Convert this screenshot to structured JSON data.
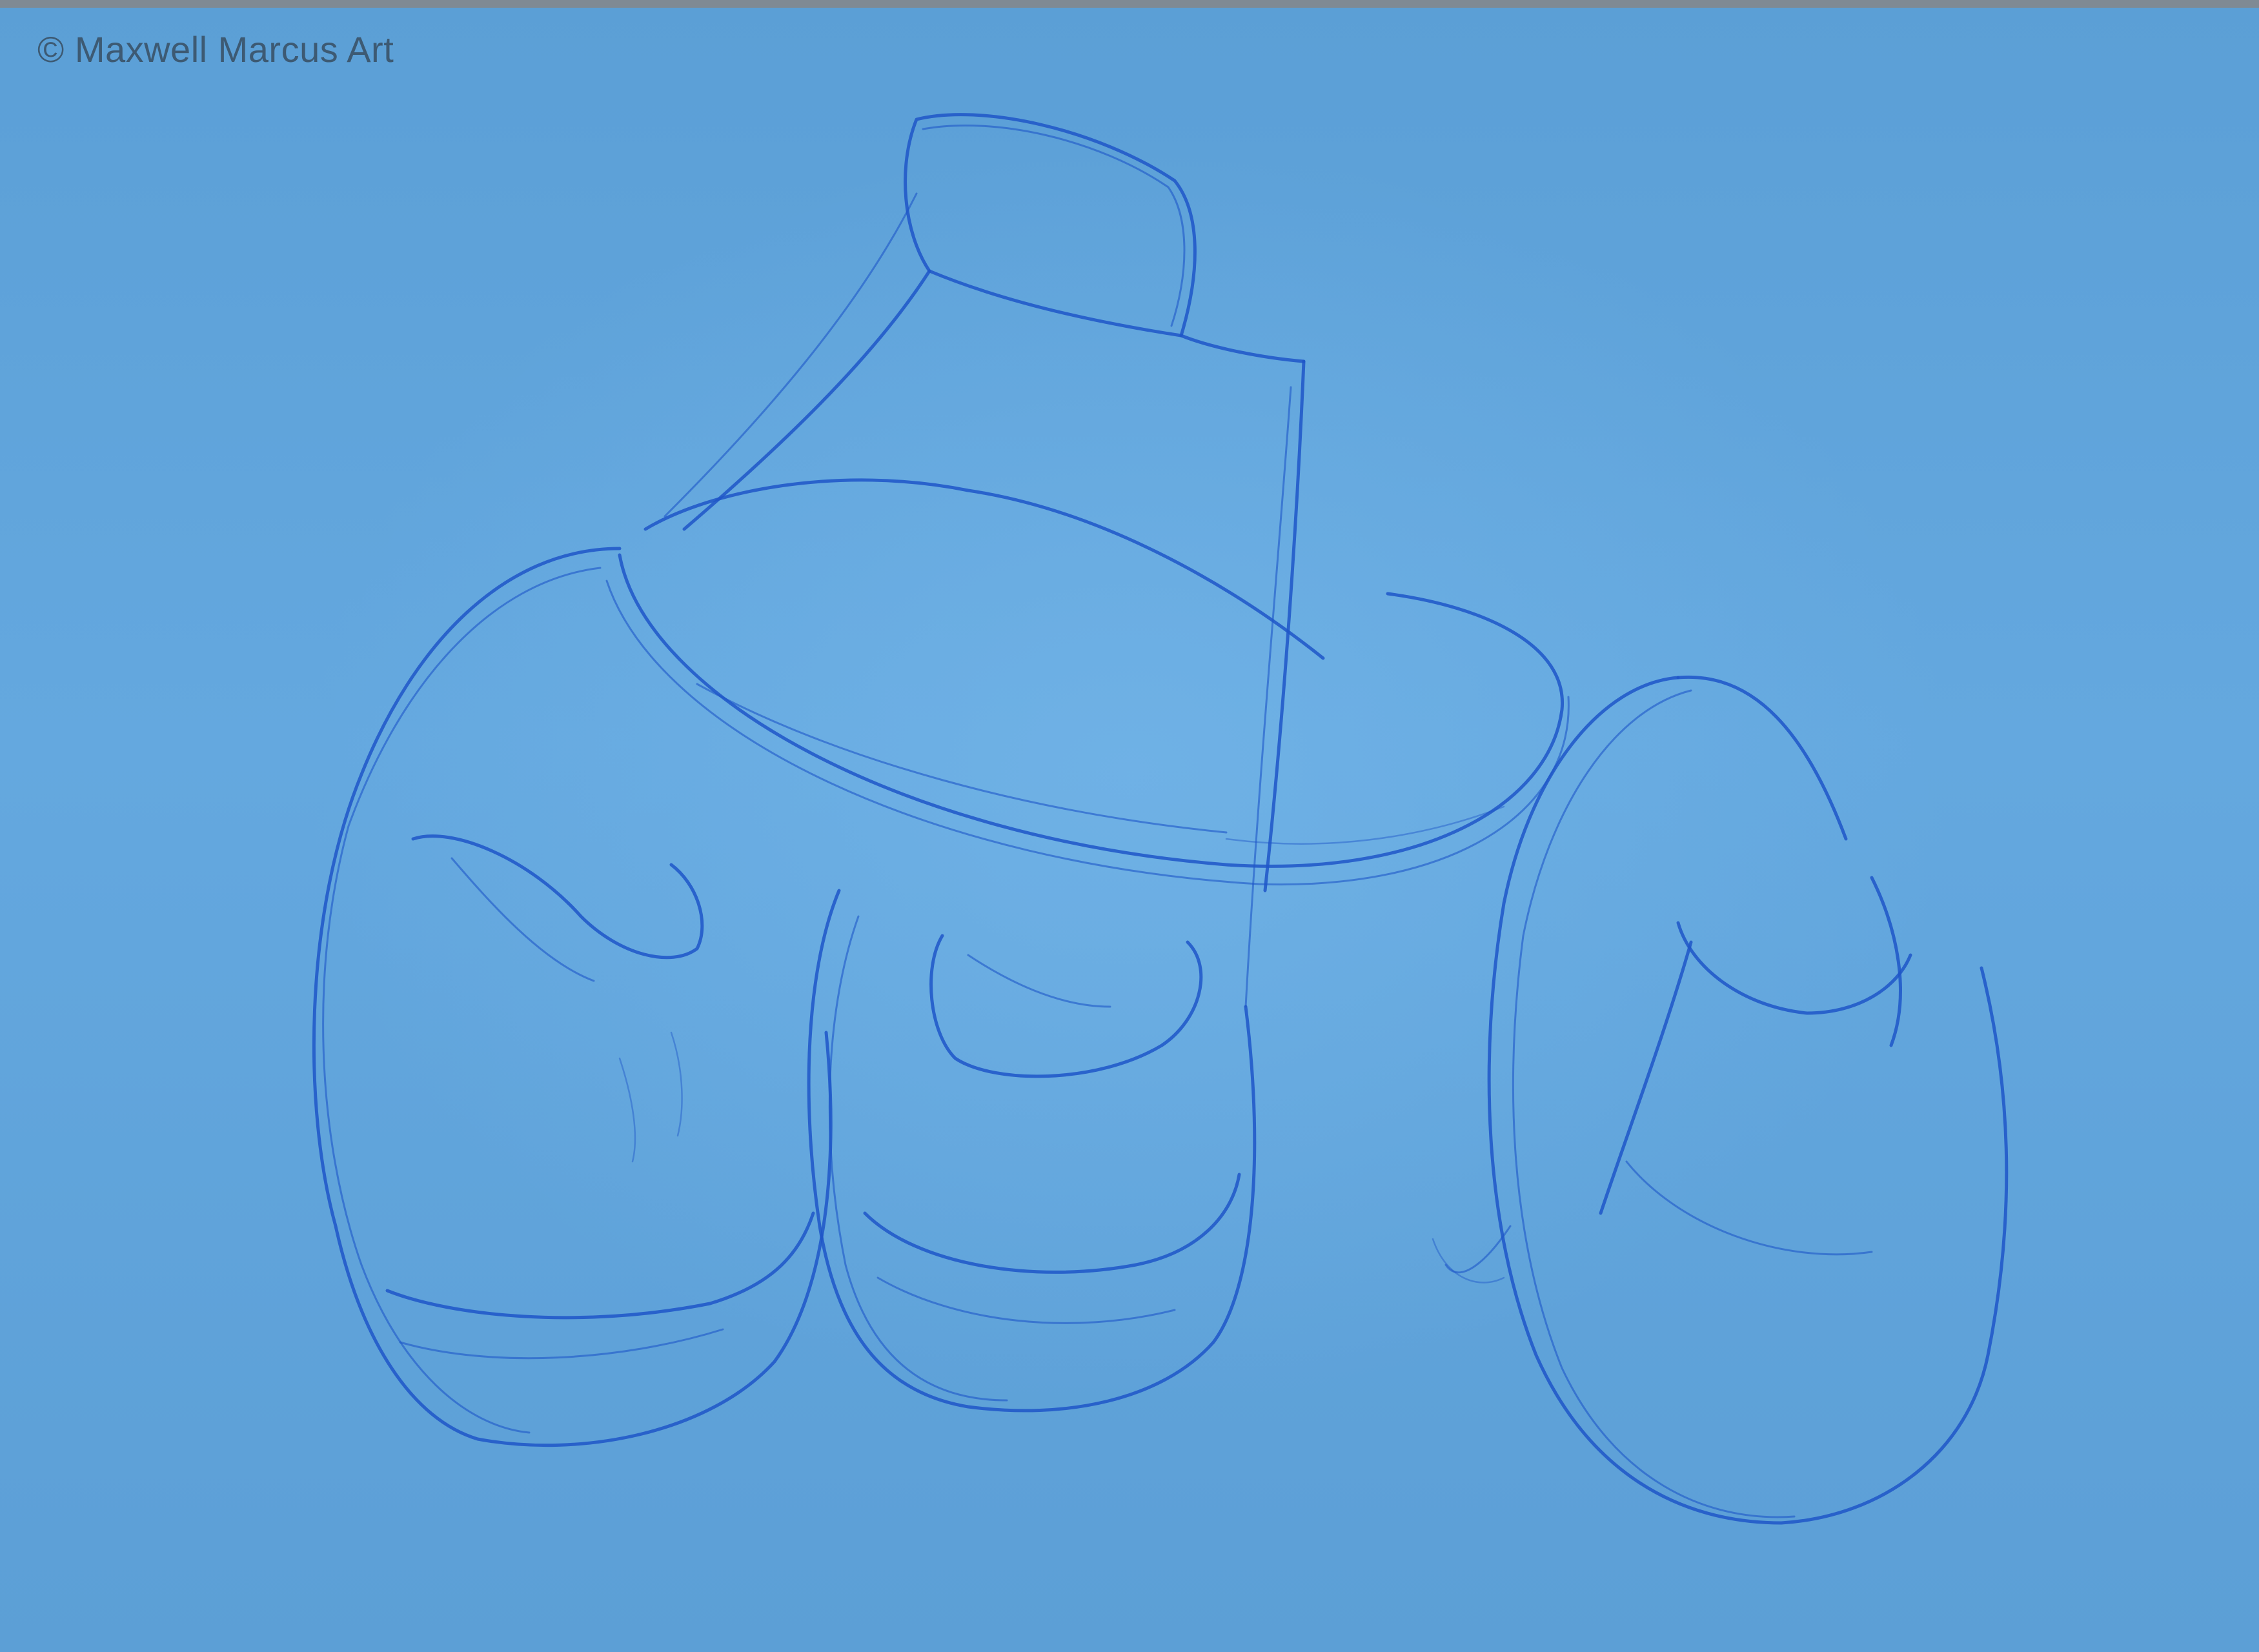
{
  "watermark": "© Maxwell Marcus Art",
  "colors": {
    "paper": "#5fa3d9",
    "ink": "#1e56c8",
    "watermark": "#3d5a73"
  }
}
